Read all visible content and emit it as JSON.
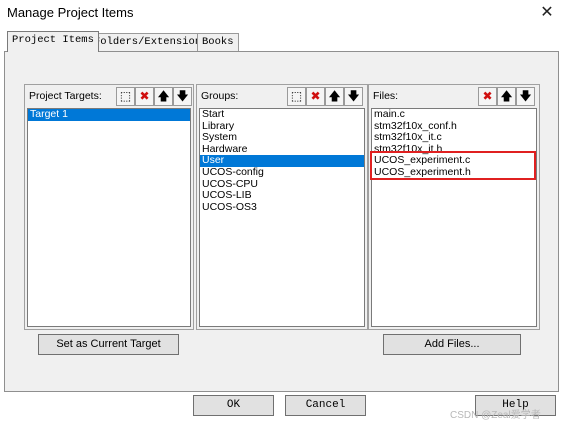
{
  "window": {
    "title": "Manage Project Items",
    "close_glyph": "✕"
  },
  "tabs": [
    {
      "label": "Project Items",
      "active": true
    },
    {
      "label": "Folders/Extensions",
      "active": false
    },
    {
      "label": "Books",
      "active": false
    }
  ],
  "targets": {
    "label": "Project Targets:",
    "items": [
      "Target 1"
    ],
    "selected": "Target 1"
  },
  "groups": {
    "label": "Groups:",
    "items": [
      "Start",
      "Library",
      "System",
      "Hardware",
      "User",
      "UCOS-config",
      "UCOS-CPU",
      "UCOS-LIB",
      "UCOS-OS3"
    ],
    "selected": "User"
  },
  "files": {
    "label": "Files:",
    "items": [
      "main.c",
      "stm32f10x_conf.h",
      "stm32f10x_it.c",
      "stm32f10x_it.h",
      "UCOS_experiment.c",
      "UCOS_experiment.h"
    ],
    "highlighted": [
      "UCOS_experiment.c",
      "UCOS_experiment.h"
    ]
  },
  "toolbar_glyphs": {
    "new": "⬚",
    "delete": "✖",
    "up": "🡅",
    "down": "🡇"
  },
  "colors": {
    "selection": "#0078d7",
    "highlight_box": "#e02020",
    "delete_icon": "#d01010"
  },
  "buttons": {
    "set_current_target": "Set as Current Target",
    "add_files": "Add Files...",
    "ok": "OK",
    "cancel": "Cancel",
    "help": "Help"
  },
  "watermark": "CSDN @Zeal爱学者"
}
